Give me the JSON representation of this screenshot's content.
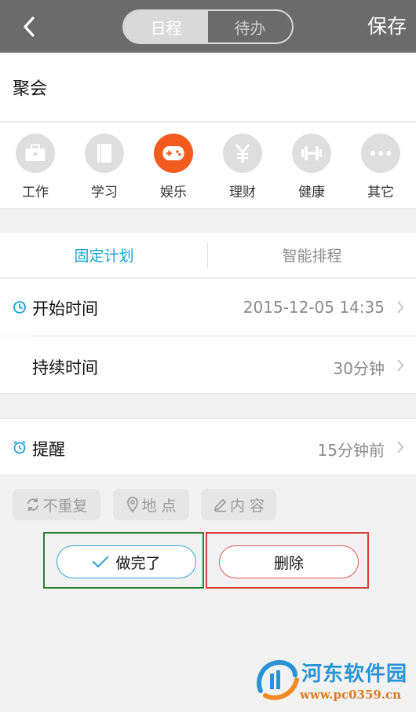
{
  "topbar": {
    "tabs": [
      "日程",
      "待办"
    ],
    "save_label": "保存"
  },
  "event": {
    "title": "聚会"
  },
  "categories": [
    {
      "label": "工作",
      "icon": "briefcase-icon"
    },
    {
      "label": "学习",
      "icon": "book-icon"
    },
    {
      "label": "娱乐",
      "icon": "gamepad-icon",
      "selected": true
    },
    {
      "label": "理财",
      "icon": "yen-icon"
    },
    {
      "label": "健康",
      "icon": "dumbbell-icon"
    },
    {
      "label": "其它",
      "icon": "more-dots-icon"
    }
  ],
  "plan_tabs": [
    "固定计划",
    "智能排程"
  ],
  "rows": {
    "start": {
      "label": "开始时间",
      "value": "2015-12-05 14:35"
    },
    "duration": {
      "label": "持续时间",
      "value": "30分钟"
    },
    "reminder": {
      "label": "提醒",
      "value": "15分钟前"
    }
  },
  "chips": {
    "repeat": "不重复",
    "location": "地 点",
    "content": "内 容"
  },
  "actions": {
    "done": "做完了",
    "delete": "删除"
  },
  "watermark": {
    "title": "河东软件园",
    "url": "www.pc0359.cn"
  },
  "colors": {
    "accent_blue": "#1aa3d6",
    "selected_category": "#f35b1e",
    "topbar": "#6b6b6b"
  }
}
